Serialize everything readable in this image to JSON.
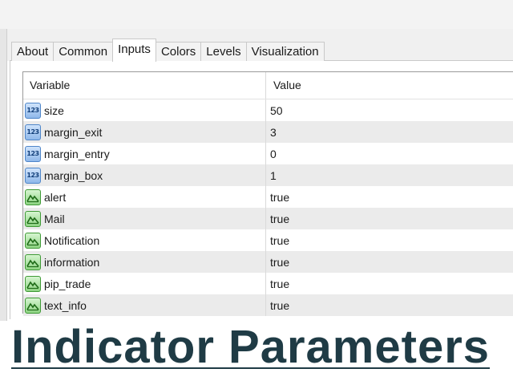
{
  "tabs": [
    {
      "label": "About",
      "active": false
    },
    {
      "label": "Common",
      "active": false
    },
    {
      "label": "Inputs",
      "active": true
    },
    {
      "label": "Colors",
      "active": false
    },
    {
      "label": "Levels",
      "active": false
    },
    {
      "label": "Visualization",
      "active": false
    }
  ],
  "grid": {
    "columns": {
      "variable": "Variable",
      "value": "Value"
    },
    "rows": [
      {
        "icon": "number-123-icon",
        "name": "size",
        "value": "50"
      },
      {
        "icon": "number-123-icon",
        "name": "margin_exit",
        "value": "3"
      },
      {
        "icon": "number-123-icon",
        "name": "margin_entry",
        "value": "0"
      },
      {
        "icon": "number-123-icon",
        "name": "margin_box",
        "value": "1"
      },
      {
        "icon": "boolean-icon",
        "name": "alert",
        "value": "true"
      },
      {
        "icon": "boolean-icon",
        "name": "Mail",
        "value": "true"
      },
      {
        "icon": "boolean-icon",
        "name": "Notification",
        "value": "true"
      },
      {
        "icon": "boolean-icon",
        "name": "information",
        "value": "true"
      },
      {
        "icon": "boolean-icon",
        "name": "pip_trade",
        "value": "true"
      },
      {
        "icon": "boolean-icon",
        "name": "text_info",
        "value": "true"
      }
    ]
  },
  "icon_text": {
    "number": "123"
  },
  "banner": {
    "title": "Indicator Parameters"
  },
  "colors": {
    "title": "#1f3b45",
    "num_icon": "#4f86c9",
    "bool_icon": "#3f9a36"
  }
}
